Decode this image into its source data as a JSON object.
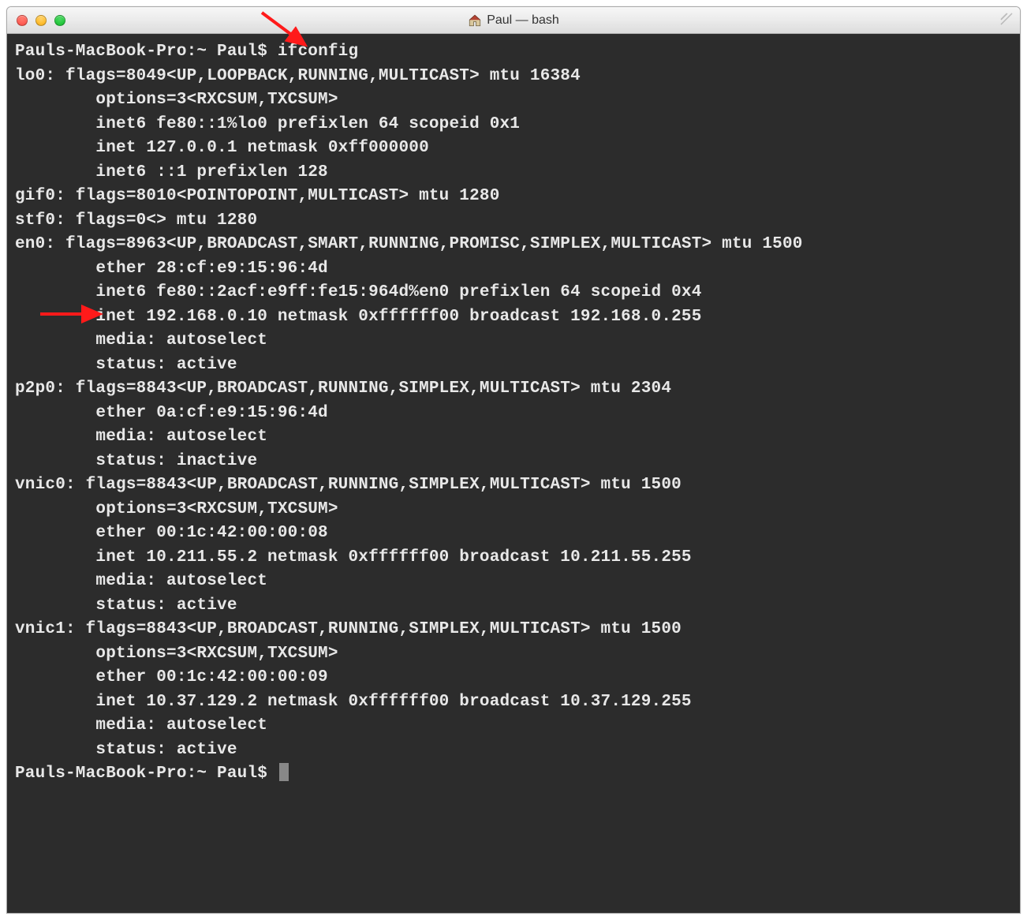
{
  "window": {
    "title": "Paul — bash",
    "icon": "home-icon"
  },
  "terminal": {
    "prompt1": "Pauls-MacBook-Pro:~ Paul$ ",
    "command": "ifconfig",
    "output_lines": [
      "lo0: flags=8049<UP,LOOPBACK,RUNNING,MULTICAST> mtu 16384",
      "        options=3<RXCSUM,TXCSUM>",
      "        inet6 fe80::1%lo0 prefixlen 64 scopeid 0x1",
      "        inet 127.0.0.1 netmask 0xff000000",
      "        inet6 ::1 prefixlen 128",
      "gif0: flags=8010<POINTOPOINT,MULTICAST> mtu 1280",
      "stf0: flags=0<> mtu 1280",
      "en0: flags=8963<UP,BROADCAST,SMART,RUNNING,PROMISC,SIMPLEX,MULTICAST> mtu 1500",
      "        ether 28:cf:e9:15:96:4d",
      "        inet6 fe80::2acf:e9ff:fe15:964d%en0 prefixlen 64 scopeid 0x4",
      "        inet 192.168.0.10 netmask 0xffffff00 broadcast 192.168.0.255",
      "        media: autoselect",
      "        status: active",
      "p2p0: flags=8843<UP,BROADCAST,RUNNING,SIMPLEX,MULTICAST> mtu 2304",
      "        ether 0a:cf:e9:15:96:4d",
      "        media: autoselect",
      "        status: inactive",
      "vnic0: flags=8843<UP,BROADCAST,RUNNING,SIMPLEX,MULTICAST> mtu 1500",
      "        options=3<RXCSUM,TXCSUM>",
      "        ether 00:1c:42:00:00:08",
      "        inet 10.211.55.2 netmask 0xffffff00 broadcast 10.211.55.255",
      "        media: autoselect",
      "        status: active",
      "vnic1: flags=8843<UP,BROADCAST,RUNNING,SIMPLEX,MULTICAST> mtu 1500",
      "        options=3<RXCSUM,TXCSUM>",
      "        ether 00:1c:42:00:00:09",
      "        inet 10.37.129.2 netmask 0xffffff00 broadcast 10.37.129.255",
      "        media: autoselect",
      "        status: active"
    ],
    "prompt2": "Pauls-MacBook-Pro:~ Paul$ "
  },
  "annotations": {
    "arrow1": {
      "points_to": "ifconfig command",
      "color": "#ff0000"
    },
    "arrow2": {
      "points_to": "inet 192.168.0.10 line",
      "color": "#ff0000"
    }
  }
}
